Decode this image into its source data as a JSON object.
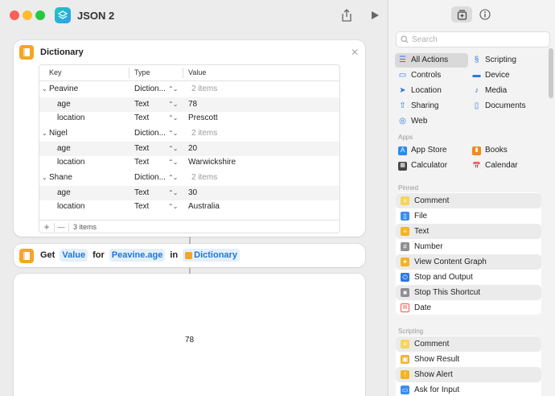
{
  "window": {
    "title": "JSON 2",
    "traffic_colors": {
      "close": "#fe5f57",
      "minimize": "#febc2e",
      "zoom": "#28c840"
    }
  },
  "dictionary_action": {
    "title": "Dictionary",
    "columns": [
      "Key",
      "Type",
      "Value"
    ],
    "rows": [
      {
        "key": "Peavine",
        "type": "Diction...",
        "value": "2 items"
      },
      {
        "key": "age",
        "type": "Text",
        "value": "78"
      },
      {
        "key": "location",
        "type": "Text",
        "value": "Prescott"
      },
      {
        "key": "Nigel",
        "type": "Diction...",
        "value": "2 items"
      },
      {
        "key": "age",
        "type": "Text",
        "value": "20"
      },
      {
        "key": "location",
        "type": "Text",
        "value": "Warwickshire"
      },
      {
        "key": "Shane",
        "type": "Diction...",
        "value": "2 items"
      },
      {
        "key": "age",
        "type": "Text",
        "value": "30"
      },
      {
        "key": "location",
        "type": "Text",
        "value": "Australia"
      }
    ],
    "footer": {
      "add": "+",
      "remove": "—",
      "count": "3 items"
    }
  },
  "get_action": {
    "verb": "Get",
    "value_token": "Value",
    "for_word": "for",
    "key_token": "Peavine.age",
    "in_word": "in",
    "dict_token": "Dictionary"
  },
  "result": {
    "value": "78"
  },
  "sidebar": {
    "search_placeholder": "Search",
    "categories": [
      {
        "label": "All Actions",
        "icon": "list-icon"
      },
      {
        "label": "Scripting",
        "icon": "scripting-icon"
      },
      {
        "label": "Controls",
        "icon": "controls-icon"
      },
      {
        "label": "Device",
        "icon": "device-icon"
      },
      {
        "label": "Location",
        "icon": "location-icon"
      },
      {
        "label": "Media",
        "icon": "music-note-icon"
      },
      {
        "label": "Sharing",
        "icon": "share-icon"
      },
      {
        "label": "Documents",
        "icon": "document-icon"
      },
      {
        "label": "Web",
        "icon": "compass-icon"
      }
    ],
    "apps_header": "Apps",
    "apps": [
      {
        "label": "App Store",
        "icon": "app-store-icon"
      },
      {
        "label": "Books",
        "icon": "books-icon"
      },
      {
        "label": "Calculator",
        "icon": "calculator-icon"
      },
      {
        "label": "Calendar",
        "icon": "calendar-icon"
      }
    ],
    "pinned_header": "Pinned",
    "pinned": [
      {
        "label": "Comment",
        "icon": "comment-icon"
      },
      {
        "label": "File",
        "icon": "file-icon"
      },
      {
        "label": "Text",
        "icon": "text-icon"
      },
      {
        "label": "Number",
        "icon": "number-icon"
      },
      {
        "label": "View Content Graph",
        "icon": "graph-icon"
      },
      {
        "label": "Stop and Output",
        "icon": "stop-output-icon"
      },
      {
        "label": "Stop This Shortcut",
        "icon": "stop-icon"
      },
      {
        "label": "Date",
        "icon": "date-icon"
      }
    ],
    "scripting_header": "Scripting",
    "scripting": [
      {
        "label": "Comment",
        "icon": "comment-icon"
      },
      {
        "label": "Show Result",
        "icon": "show-result-icon"
      },
      {
        "label": "Show Alert",
        "icon": "alert-icon"
      },
      {
        "label": "Ask for Input",
        "icon": "ask-input-icon"
      }
    ]
  }
}
